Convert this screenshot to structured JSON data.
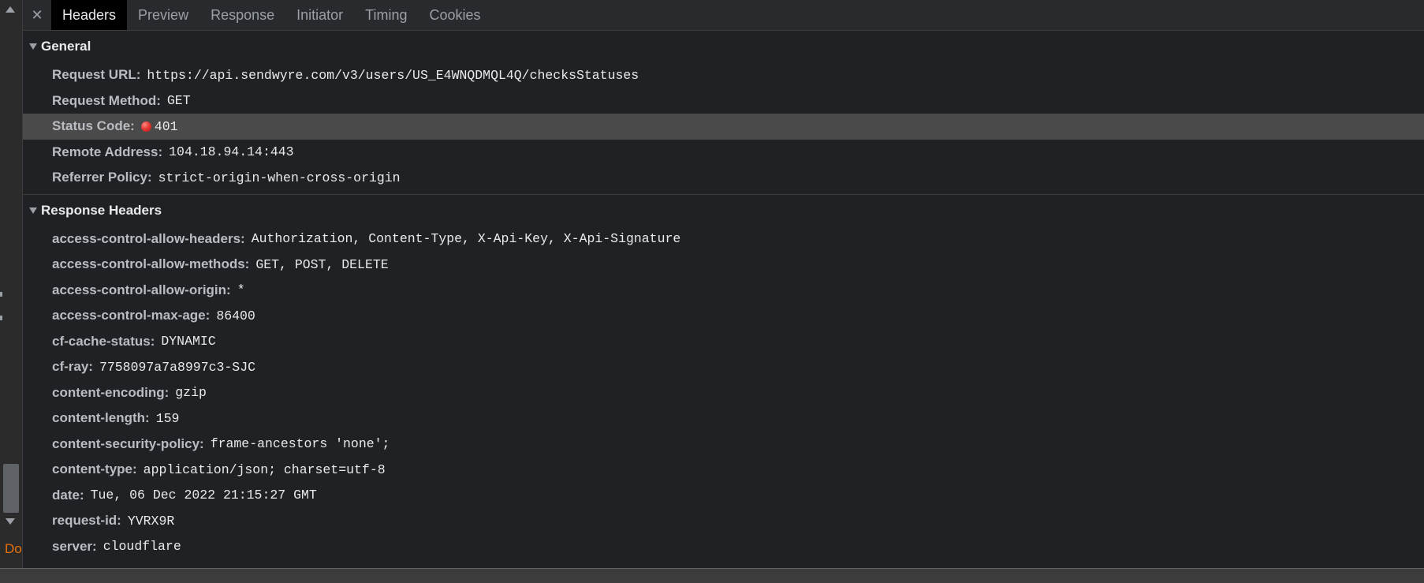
{
  "tabs": [
    "Headers",
    "Preview",
    "Response",
    "Initiator",
    "Timing",
    "Cookies"
  ],
  "left_strip_cutoff_text": "Do",
  "general": {
    "title": "General",
    "rows": [
      {
        "key": "Request URL:",
        "value": "https://api.sendwyre.com/v3/users/US_E4WNQDMQL4Q/checksStatuses"
      },
      {
        "key": "Request Method:",
        "value": "GET"
      },
      {
        "key": "Status Code:",
        "value": "401"
      },
      {
        "key": "Remote Address:",
        "value": "104.18.94.14:443"
      },
      {
        "key": "Referrer Policy:",
        "value": "strict-origin-when-cross-origin"
      }
    ]
  },
  "response_headers": {
    "title": "Response Headers",
    "rows": [
      {
        "key": "access-control-allow-headers:",
        "value": "Authorization, Content-Type, X-Api-Key, X-Api-Signature"
      },
      {
        "key": "access-control-allow-methods:",
        "value": "GET, POST, DELETE"
      },
      {
        "key": "access-control-allow-origin:",
        "value": "*"
      },
      {
        "key": "access-control-max-age:",
        "value": "86400"
      },
      {
        "key": "cf-cache-status:",
        "value": "DYNAMIC"
      },
      {
        "key": "cf-ray:",
        "value": "7758097a7a8997c3-SJC"
      },
      {
        "key": "content-encoding:",
        "value": "gzip"
      },
      {
        "key": "content-length:",
        "value": "159"
      },
      {
        "key": "content-security-policy:",
        "value": "frame-ancestors 'none';"
      },
      {
        "key": "content-type:",
        "value": "application/json; charset=utf-8"
      },
      {
        "key": "date:",
        "value": "Tue, 06 Dec 2022 21:15:27 GMT"
      },
      {
        "key": "request-id:",
        "value": "YVRX9R"
      },
      {
        "key": "server:",
        "value": "cloudflare"
      }
    ]
  },
  "colors": {
    "background": "#202124",
    "tabbar": "#292a2d",
    "active_tab": "#000000",
    "highlight_row": "#4a4a4a",
    "status_error": "#e53935"
  },
  "icons": {
    "close": "close-icon",
    "collapse": "triangle-down-icon",
    "status": "status-error-dot-icon"
  }
}
